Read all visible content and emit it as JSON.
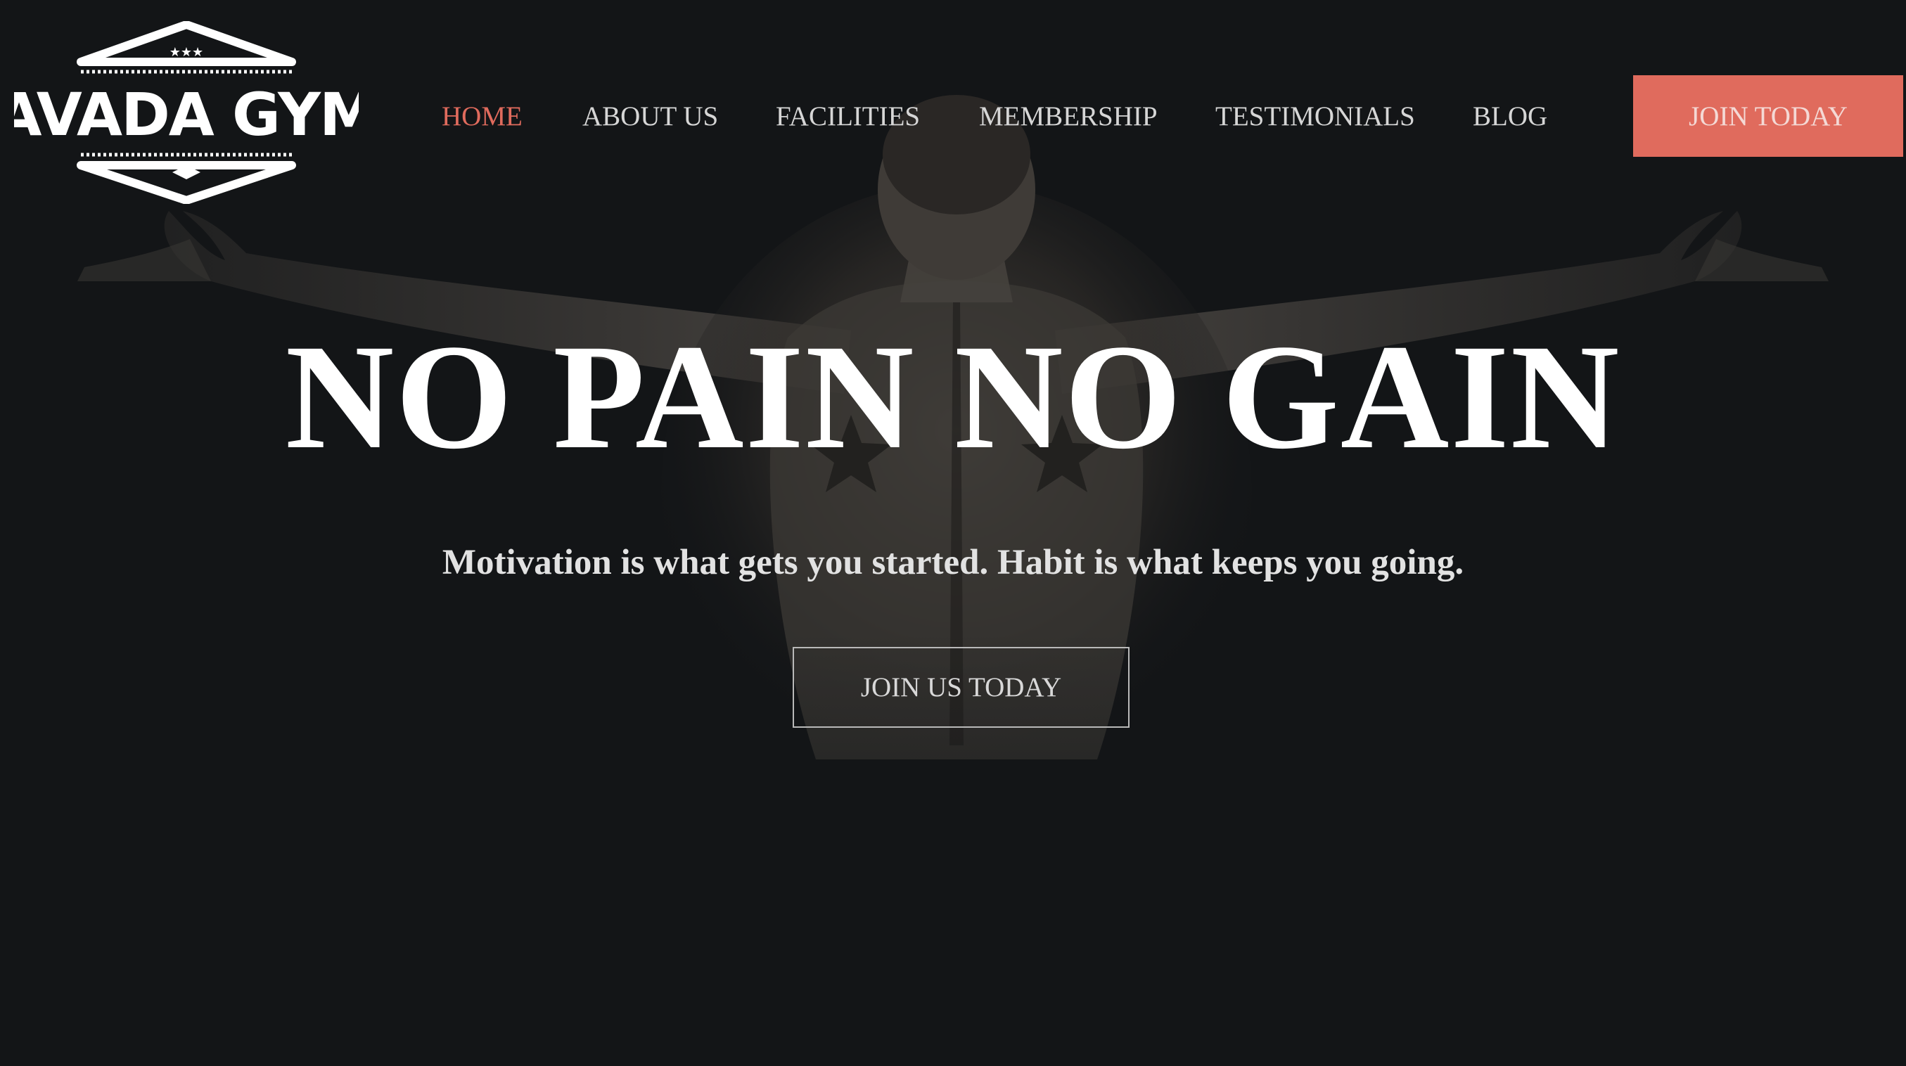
{
  "brand": {
    "logo_text": "AVADA GYM"
  },
  "nav": {
    "items": [
      {
        "label": "HOME",
        "active": true
      },
      {
        "label": "ABOUT US",
        "active": false
      },
      {
        "label": "FACILITIES",
        "active": false
      },
      {
        "label": "MEMBERSHIP",
        "active": false
      },
      {
        "label": "TESTIMONIALS",
        "active": false
      },
      {
        "label": "BLOG",
        "active": false
      }
    ],
    "join_label": "JOIN TODAY"
  },
  "hero": {
    "headline": "NO PAIN NO GAIN",
    "tagline": "Motivation is what gets you started. Habit is what keeps you going.",
    "cta_label": "JOIN US TODAY"
  },
  "colors": {
    "background": "#131517",
    "accent": "#e06b5d",
    "nav_text": "#d6d6d6",
    "headline": "#ffffff"
  }
}
